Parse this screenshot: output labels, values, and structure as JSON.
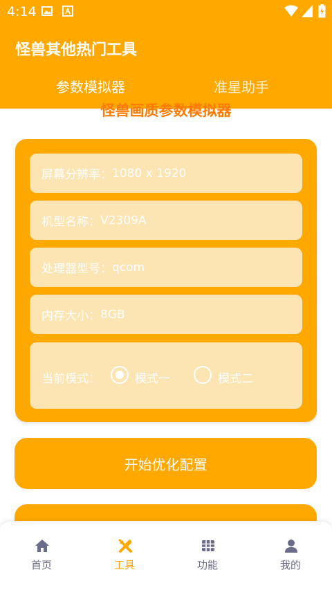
{
  "status_bar": {
    "time": "4:14"
  },
  "app_bar": {
    "title": "怪兽其他热门工具",
    "tabs": [
      {
        "label": "参数模拟器",
        "active": true
      },
      {
        "label": "准星助手",
        "active": false
      }
    ]
  },
  "main": {
    "section_title": "怪兽画质参数模拟器",
    "fields": [
      {
        "label": "屏幕分辨率：",
        "value": "1080 x 1920"
      },
      {
        "label": "机型名称：",
        "value": "V2309A"
      },
      {
        "label": "处理器型号：",
        "value": "qcom"
      },
      {
        "label": "内存大小：",
        "value": "8GB"
      }
    ],
    "mode": {
      "label": "当前模式：",
      "options": [
        {
          "label": "模式一",
          "checked": true
        },
        {
          "label": "模式二",
          "checked": false
        }
      ]
    },
    "start_button": "开始优化配置"
  },
  "bottom_nav": {
    "items": [
      {
        "label": "首页",
        "icon": "home-icon",
        "active": false
      },
      {
        "label": "工具",
        "icon": "tools-icon",
        "active": true
      },
      {
        "label": "功能",
        "icon": "grid-icon",
        "active": false
      },
      {
        "label": "我的",
        "icon": "person-icon",
        "active": false
      }
    ]
  },
  "colors": {
    "accent": "#FFA800",
    "section_title": "#FF7A00",
    "field_bg": "#FDE4B3",
    "nav_inactive": "#6B6B8A"
  }
}
